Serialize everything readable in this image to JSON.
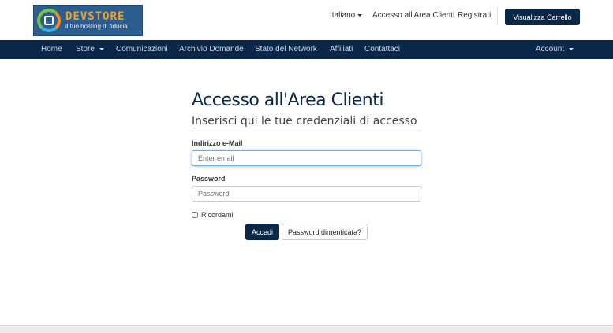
{
  "header": {
    "logo": {
      "title": "DEVSTORE",
      "tagline": "il tuo hosting di fiducia"
    },
    "language": "Italiano",
    "login_link": "Accesso all'Area Clienti",
    "register_link": "Registrati",
    "cart_button": "Visualizza Carrello"
  },
  "nav": {
    "items": [
      "Home",
      "Store",
      "Comunicazioni",
      "Archivio Domande",
      "Stato del Network",
      "Affiliati",
      "Contattaci"
    ],
    "account": "Account"
  },
  "main": {
    "title": "Accesso all'Area Clienti",
    "subtitle": "Inserisci qui le tue credenziali di accesso",
    "email_label": "Indirizzo e-Mail",
    "email_placeholder": "Enter email",
    "password_label": "Password",
    "password_placeholder": "Password",
    "remember_label": "Ricordami",
    "login_button": "Accedi",
    "forgot_button": "Password dimenticata?"
  },
  "colors": {
    "brand_navy": "#0b2748",
    "focus_blue": "#66afe9"
  }
}
